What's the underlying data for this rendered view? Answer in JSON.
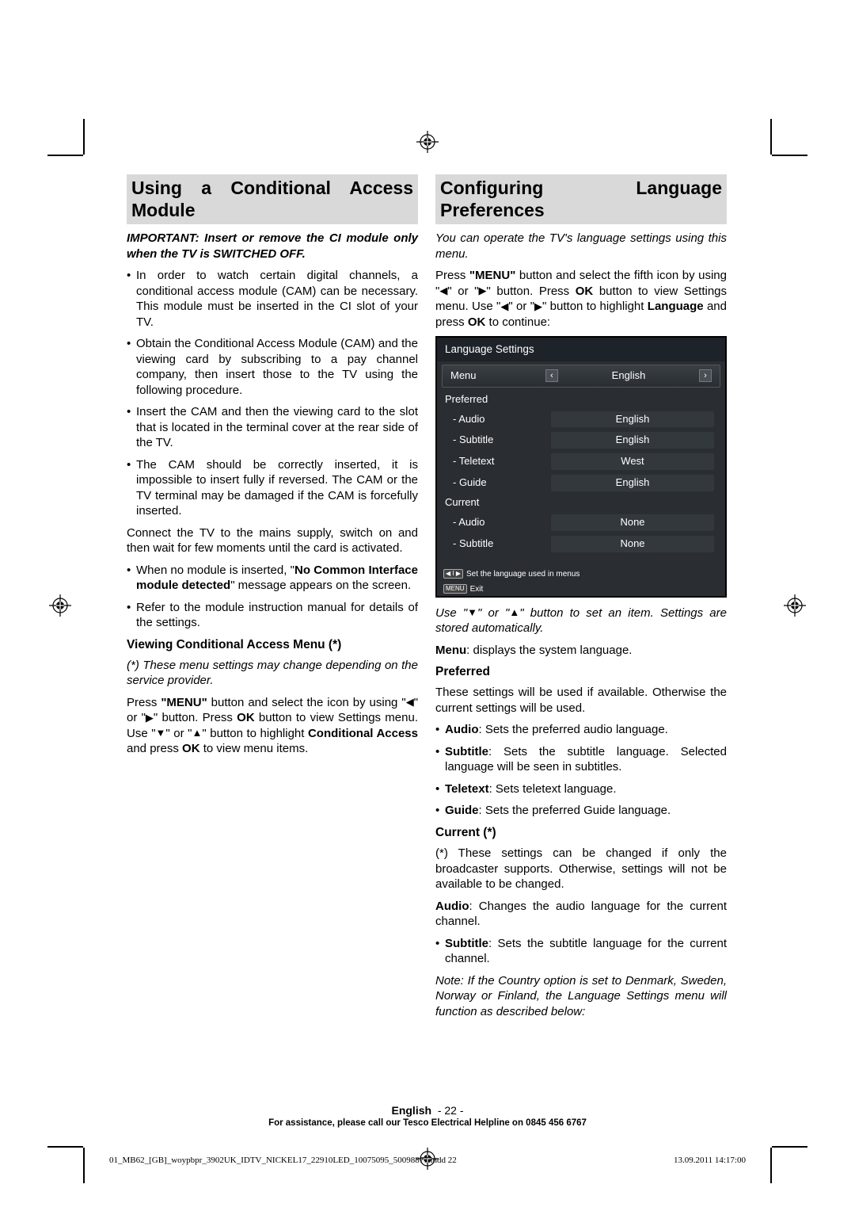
{
  "left_column": {
    "heading": "Using a Conditional Access Module",
    "important": "IMPORTANT: Insert or remove the CI module only when the TV is SWITCHED OFF.",
    "bullets1": [
      "In order to watch certain digital channels, a conditional access module (CAM) can be necessary. This module must be inserted in the CI slot of your TV.",
      "Obtain the Conditional Access Module (CAM) and the viewing card by subscribing to a pay channel company, then insert those to the TV using the following procedure.",
      "Insert the CAM and then the viewing card to the slot that is located in the terminal cover at the rear side of the TV.",
      "The CAM should be correctly inserted, it is impossible to insert fully if reversed. The CAM or the TV terminal may be damaged if the CAM is forcefully inserted."
    ],
    "para_connect": "Connect the TV to the mains supply, switch on and then wait for few moments until the card is activated.",
    "bullets2_pre": "When no module is inserted, \"",
    "bullets2_bold": "No Common Interface module detected",
    "bullets2_post": "\" message appears on the screen.",
    "bullets2_b": "Refer to the module instruction manual for details of the settings.",
    "sub_heading": "Viewing Conditional Access Menu (*)",
    "note_star": "(*) These menu settings may change depending on the service provider.",
    "press_pre": "Press ",
    "press_menu": "\"MENU\"",
    "press_mid": " button and select the icon by using \"",
    "press_mid2": "\" or \"",
    "press_mid3": "\" button. Press ",
    "press_ok": "OK",
    "press_mid4": " button to view Settings menu. Use \"",
    "press_mid5": "\" or \"",
    "press_mid6": "\" button to highlight ",
    "press_ca": "Conditional Access",
    "press_mid7": " and press ",
    "press_end": " to view menu items."
  },
  "right_column": {
    "heading": "Configuring Language Preferences",
    "intro_italic": "You can operate the TV's language settings using this menu.",
    "press_pre": "Press ",
    "press_menu": "\"MENU\"",
    "press_mid1": " button and select the fifth icon by using \"",
    "press_mid2": "\" or \"",
    "press_mid3": "\" button. Press ",
    "press_ok": "OK",
    "press_mid4": " button to view Settings menu. Use \"",
    "press_mid5": "\" or \"",
    "press_mid6": "\" button to highlight ",
    "press_lang": "Language",
    "press_mid7": " and press ",
    "press_end": " to continue:",
    "menu": {
      "title": "Language Settings",
      "rows": {
        "menu_label": "Menu",
        "menu_value": "English",
        "preferred_label": "Preferred",
        "audio_label": "- Audio",
        "audio_value": "English",
        "subtitle_label": "- Subtitle",
        "subtitle_value": "English",
        "teletext_label": "- Teletext",
        "teletext_value": "West",
        "guide_label": "- Guide",
        "guide_value": "English",
        "current_label": "Current",
        "caudio_label": "- Audio",
        "caudio_value": "None",
        "csubtitle_label": "- Subtitle",
        "csubtitle_value": "None"
      },
      "hint1": "Set the language used in menus",
      "hint2": "Exit",
      "badge_nav": "◀ I ▶",
      "badge_menu": "MENU"
    },
    "use_italic_pre": "Use \"",
    "use_italic_mid": "\" or \"",
    "use_italic_post": "\" button to set an item. Settings are stored automatically.",
    "menu_desc_bold": "Menu",
    "menu_desc": ": displays the system language.",
    "preferred_heading": "Preferred",
    "preferred_text": "These settings will be used if available. Otherwise the current settings will be used.",
    "pref_bullets": {
      "audio_b": "Audio",
      "audio_t": ": Sets the preferred audio language.",
      "subtitle_b": "Subtitle",
      "subtitle_t": ": Sets the subtitle language. Selected language will be seen in subtitles.",
      "teletext_b": "Teletext",
      "teletext_t": ": Sets teletext language.",
      "guide_b": "Guide",
      "guide_t": ": Sets the preferred Guide language."
    },
    "current_heading": "Current (*)",
    "current_text": "(*) These settings can be changed if only the broadcaster supports. Otherwise, settings will not be available to be changed.",
    "current_audio_b": "Audio",
    "current_audio_t": ": Changes the audio language for the current channel.",
    "current_subtitle_b": "Subtitle",
    "current_subtitle_t": ": Sets the subtitle language for the current channel.",
    "note_text": "Note: If the Country option is set to Denmark, Sweden, Norway or Finland, the Language Settings menu will function as described below:"
  },
  "footer": {
    "lang": "English",
    "page": "- 22 -",
    "help": "For assistance, please call our Tesco Electrical Helpline on 0845 456 6767"
  },
  "print": {
    "file": "01_MB62_[GB]_woypbpr_3902UK_IDTV_NICKEL17_22910LED_10075095_50098877.indd   22",
    "date": "13.09.2011   14:17:00"
  }
}
